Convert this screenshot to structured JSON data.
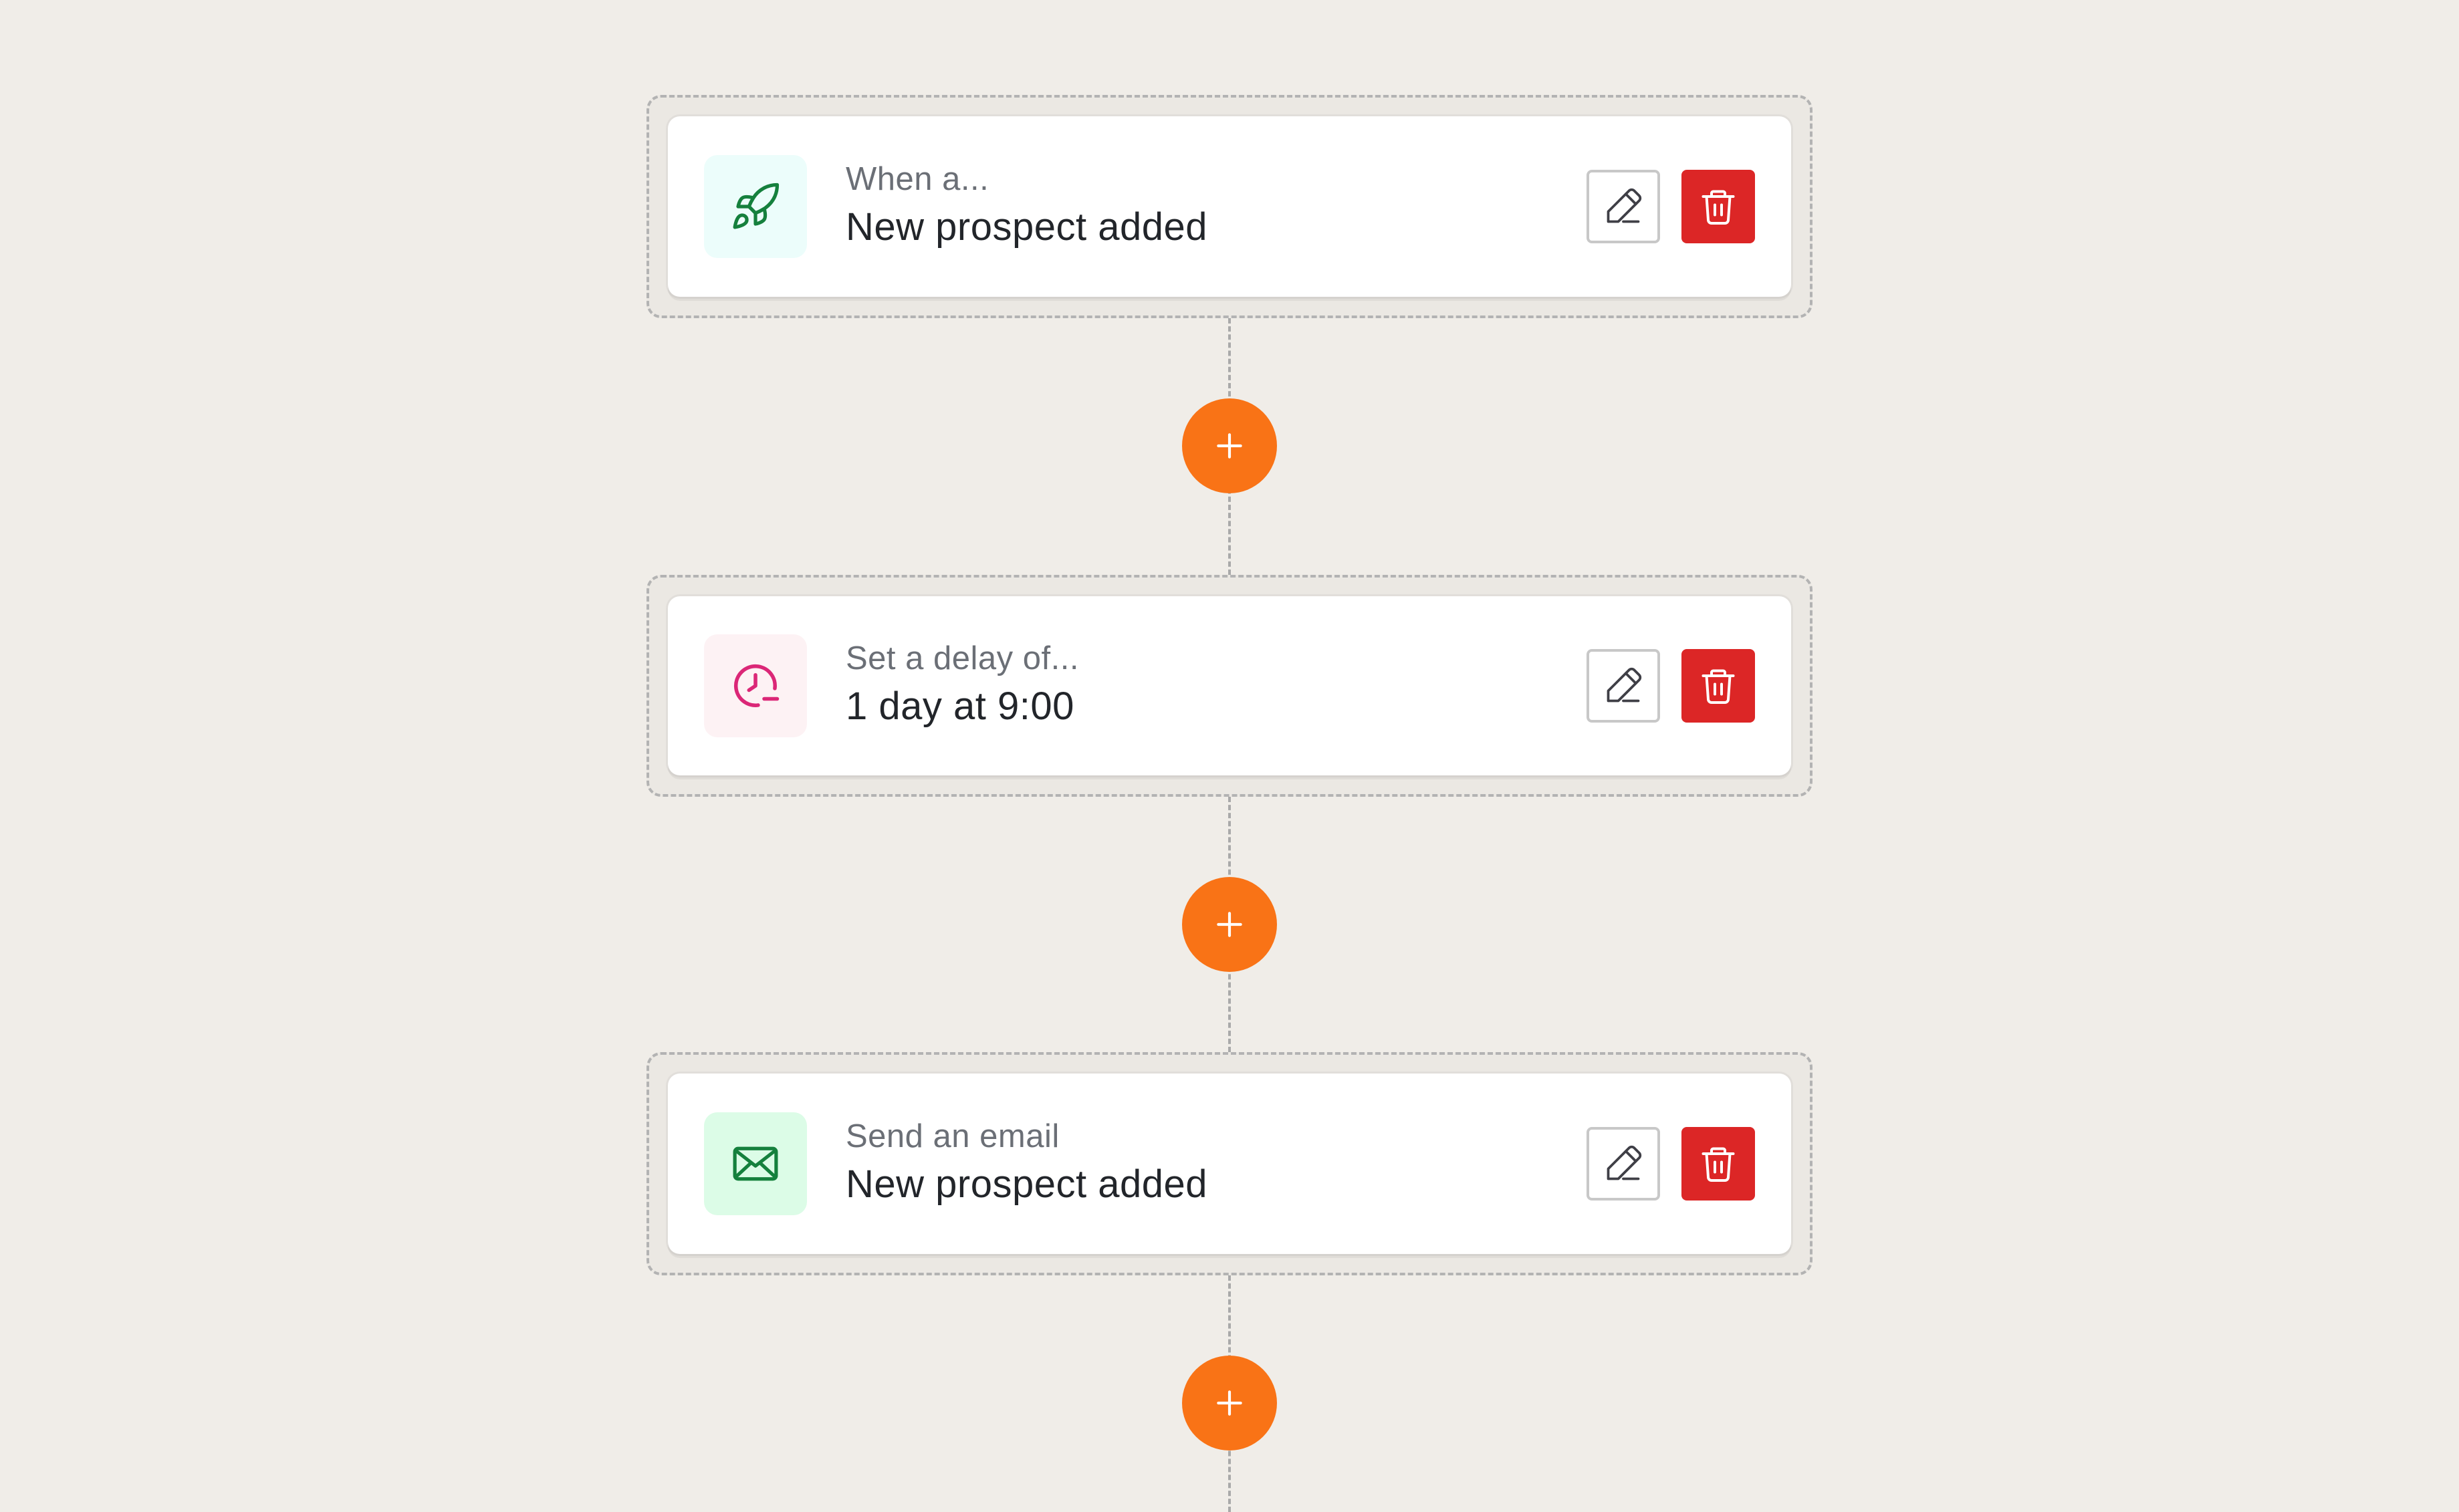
{
  "steps": [
    {
      "kicker": "When a...",
      "title": "New prospect added",
      "icon": "rocket-icon",
      "icon_color": "#15803d",
      "tile_color": "#ecfdfb"
    },
    {
      "kicker": "Set a delay of...",
      "title": "1 day at 9:00",
      "icon": "clock-delay-icon",
      "icon_color": "#db2777",
      "tile_color": "#fdf2f4"
    },
    {
      "kicker": "Send an email",
      "title": "New prospect added",
      "icon": "mail-icon",
      "icon_color": "#15803d",
      "tile_color": "#dcfce7"
    }
  ],
  "colors": {
    "background": "#f0ede8",
    "add_button": "#f97316",
    "delete_button": "#dc2626"
  },
  "actions": {
    "edit": "pencil-icon",
    "delete": "trash-icon",
    "add": "plus-icon"
  }
}
